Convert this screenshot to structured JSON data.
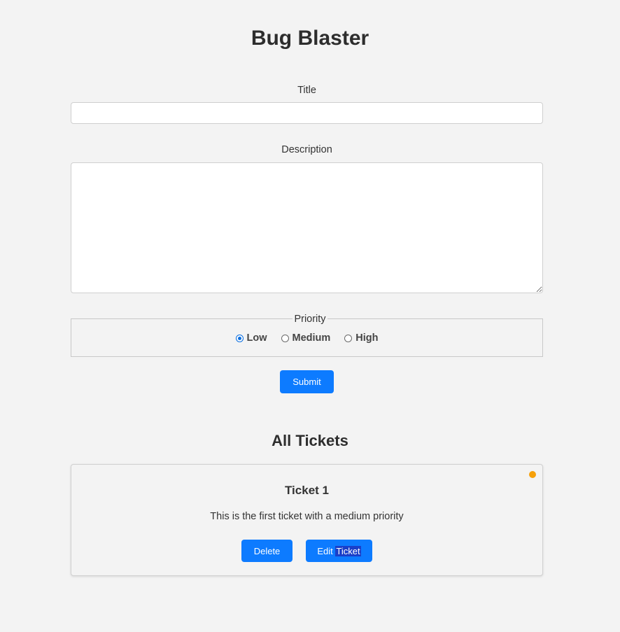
{
  "app": {
    "title": "Bug Blaster"
  },
  "form": {
    "title_label": "Title",
    "title_value": "",
    "description_label": "Description",
    "description_value": "",
    "priority_legend": "Priority",
    "priority_options": [
      {
        "label": "Low",
        "checked": true
      },
      {
        "label": "Medium",
        "checked": false
      },
      {
        "label": "High",
        "checked": false
      }
    ],
    "submit_label": "Submit"
  },
  "tickets_section": {
    "heading": "All Tickets",
    "tickets": [
      {
        "title": "Ticket 1",
        "description": "This is the first ticket with a medium priority",
        "priority_color": "#f6a00a",
        "delete_label": "Delete",
        "edit_label_prefix": "Edit",
        "edit_label_highlighted": "Ticket"
      }
    ]
  },
  "colors": {
    "background": "#f3f3f3",
    "accent": "#0d7bff",
    "medium_priority": "#f6a00a"
  }
}
